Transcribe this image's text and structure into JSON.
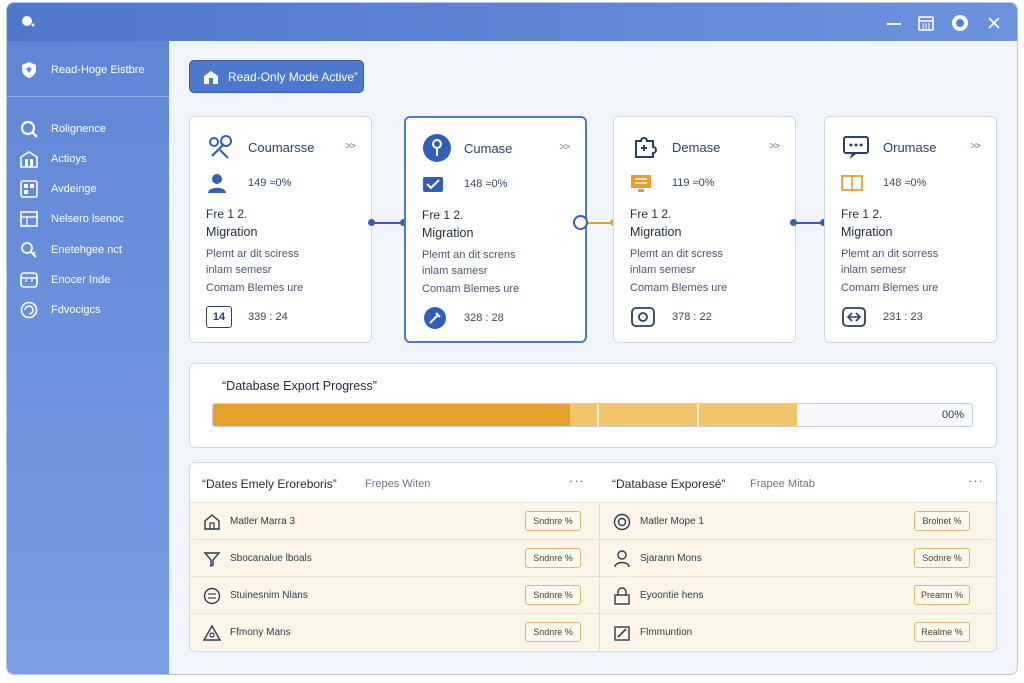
{
  "colors": {
    "accent": "#4f7bcc",
    "titlebar": "#5a82d3",
    "sidebar": "#6a8fdc",
    "progress_orange": "#e6a12c",
    "progress_light": "#f2c56a",
    "row_bg": "#fdf5e7"
  },
  "sidebar": {
    "brand": {
      "label": "Read-Hoge Eistbre",
      "icon": "shield-icon"
    },
    "items": [
      {
        "label": "Rolignence",
        "icon": "search-icon"
      },
      {
        "label": "Actioys",
        "icon": "building-icon"
      },
      {
        "label": "Avdeinge",
        "icon": "grid-icon"
      },
      {
        "label": "Nelsero lsenoc",
        "icon": "table-icon"
      },
      {
        "label": "Enetehgee nct",
        "icon": "key-search-icon"
      },
      {
        "label": "Enocer Inde",
        "icon": "window-icon"
      },
      {
        "label": "Fdvocigcs",
        "icon": "refresh-icon"
      }
    ]
  },
  "banner": {
    "label": "Read-Only Mode Active”"
  },
  "cards": [
    {
      "title": "Coumarsse",
      "arrow": ">>",
      "stat": "149 ≈0%",
      "subtitle": "Fre 1 2.",
      "label": "Migration",
      "desc1": "Plemt ar dit sciress",
      "desc2": "inlam semesr",
      "desc3": "Comam Blemes ure",
      "foot": "339 : 24",
      "foot_icon_text": "14"
    },
    {
      "title": "Cumase",
      "arrow": ">>",
      "stat": "148 ≈0%",
      "subtitle": "Fre 1 2.",
      "label": "Migration",
      "desc1": "Plemt an dit screns",
      "desc2": "inlam samesr",
      "desc3": "Comam Blemes ure",
      "foot": "328 : 28"
    },
    {
      "title": "Demase",
      "arrow": ">>",
      "stat": "119 ≈0%",
      "subtitle": "Fre 1 2.",
      "label": "Migration",
      "desc1": "Plemt an dit scress",
      "desc2": "inlam semesr",
      "desc3": "Comam Blemes ure",
      "foot": "378 : 22"
    },
    {
      "title": "Orumase",
      "arrow": ">>",
      "stat": "148 ≈0%",
      "subtitle": "Fre 1 2.",
      "label": "Migration",
      "desc1": "Plemt an dit sorress",
      "desc2": "inlam semesr",
      "desc3": "Comam Blemes ure",
      "foot": "231 : 23"
    }
  ],
  "progress": {
    "title": "“Database Export Progress”",
    "percent_label": "00%",
    "orange_fill": 0.47,
    "light_fill": 0.77
  },
  "table_left": {
    "title": "“Dates Emely Eroreboris”",
    "subtitle": "Frepes Witen",
    "more": "···",
    "rows": [
      {
        "label": "Matler Marra 3",
        "badge": "Sndnre %",
        "icon": "house-icon"
      },
      {
        "label": "Sbocanalue lboals",
        "badge": "Sndnre %",
        "icon": "filter-icon"
      },
      {
        "label": "Stuinesnim Nlans",
        "badge": "Sndnre %",
        "icon": "circle-menu-icon"
      },
      {
        "label": "Ffmony Mans",
        "badge": "Sndnre %",
        "icon": "triangle-icon"
      }
    ]
  },
  "table_right": {
    "title": "“Database Exporesé”",
    "subtitle": "Frapee Mitab",
    "more": "···",
    "rows": [
      {
        "label": "Matler Mope 1",
        "badge": "Brolnet %",
        "icon": "circle-icon"
      },
      {
        "label": "Sjarann Mons",
        "badge": "Sodnre %",
        "icon": "person-icon"
      },
      {
        "label": "Eyoontie hens",
        "badge": "Preamn %",
        "icon": "lock-icon"
      },
      {
        "label": "Flmmuntion",
        "badge": "Realme %",
        "icon": "edit-icon"
      }
    ]
  }
}
